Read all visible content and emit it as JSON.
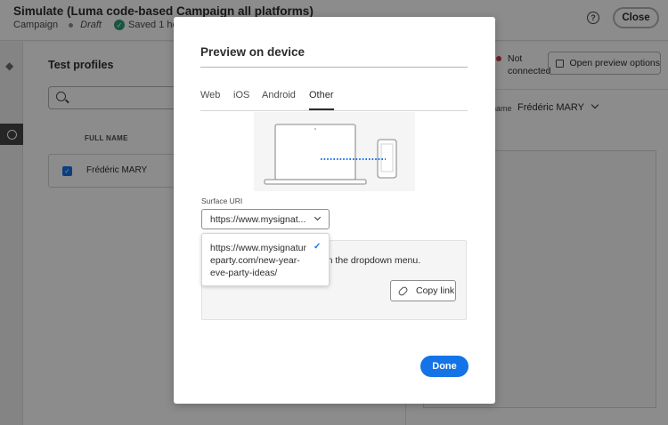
{
  "app": {
    "title": "Simulate (Luma code-based Campaign all platforms)",
    "type": "Campaign",
    "state": "Draft",
    "saved": "Saved 1 ho",
    "help_icon": "help-icon",
    "close_label": "Close"
  },
  "profiles": {
    "title": "Test profiles",
    "column_header": "FULL NAME",
    "rows": [
      {
        "name": "Frédéric MARY",
        "checked": true
      }
    ]
  },
  "right": {
    "status": "Not connected",
    "status_line1": "Not",
    "status_line2": "connected",
    "preview_button": "Open preview options",
    "name_label": "name",
    "name_value": "Frédéric MARY"
  },
  "dialog": {
    "title": "Preview on device",
    "tabs": [
      {
        "label": "Web",
        "active": false
      },
      {
        "label": "iOS",
        "active": false
      },
      {
        "label": "Android",
        "active": false
      },
      {
        "label": "Other",
        "active": true
      }
    ],
    "surface_label": "Surface URI",
    "surface_value": "https://www.mysignat...",
    "dropdown_option": "https://www.mysignatureparty.com/new-year-eve-party-ideas/",
    "dropdown_line1": "https://www.mysignatur",
    "dropdown_line2": "eparty.com/new-year-",
    "dropdown_line3": "eve-party-ideas/",
    "info_text": "w from the dropdown menu.",
    "copy_link": "Copy link",
    "done": "Done"
  },
  "colors": {
    "accent": "#1473e6",
    "overlay": "rgba(0,0,0,0.45)",
    "saved_check": "#2d9d78",
    "status_dot": "#d7373f"
  }
}
